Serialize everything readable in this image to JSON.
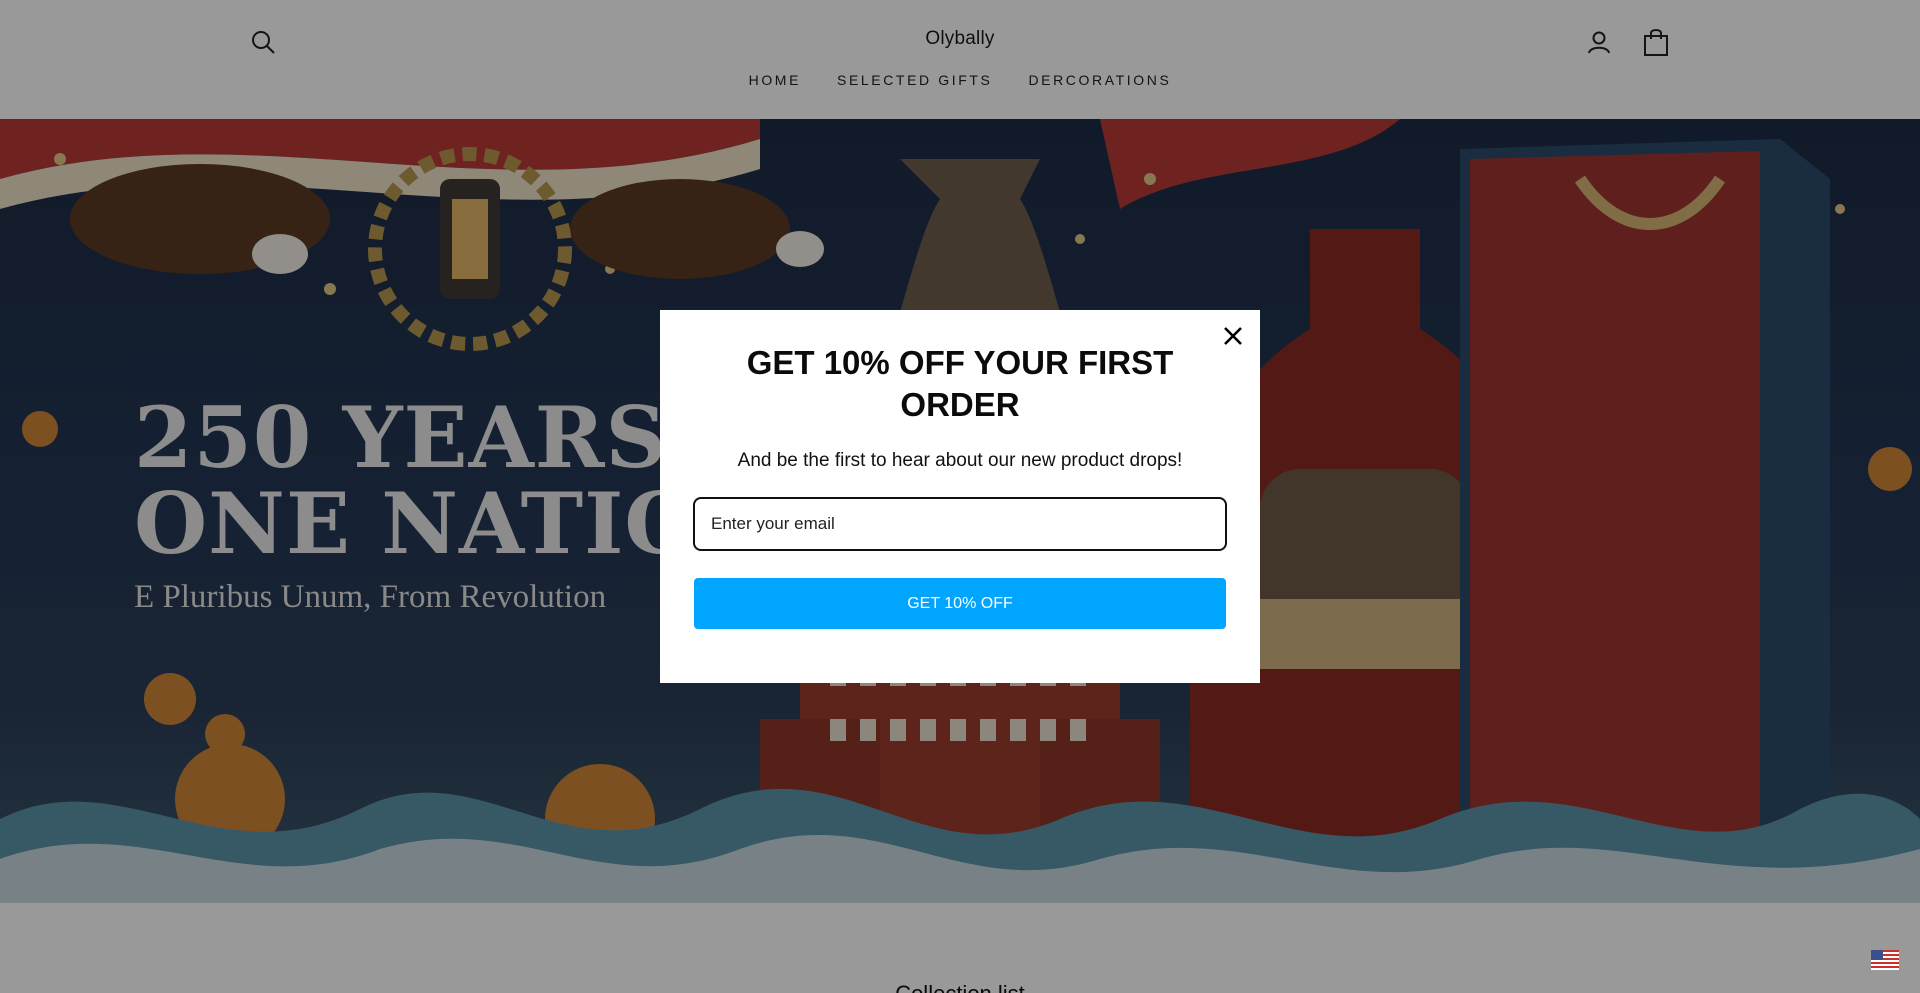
{
  "header": {
    "brand": "Olybally",
    "nav": [
      "HOME",
      "SELECTED GIFTS",
      "DERCORATIONS"
    ],
    "icons": {
      "search": "search-icon",
      "account": "user-icon",
      "cart": "bag-icon"
    }
  },
  "hero": {
    "headline": "250 YEARS O\nONE NATIO",
    "subtitle": "E Pluribus Unum, From Revolution"
  },
  "section": {
    "title": "Collection list"
  },
  "popup": {
    "title": "GET 10% OFF YOUR FIRST ORDER",
    "subtitle": "And be the first to hear about our new product drops!",
    "email_placeholder": "Enter your email",
    "button_label": "GET 10% OFF",
    "close_icon": "close-icon"
  },
  "colors": {
    "cta": "#00a5ff",
    "overlay": "rgba(0,0,0,0.40)"
  },
  "locale": {
    "flag_icon": "us-flag-icon"
  }
}
